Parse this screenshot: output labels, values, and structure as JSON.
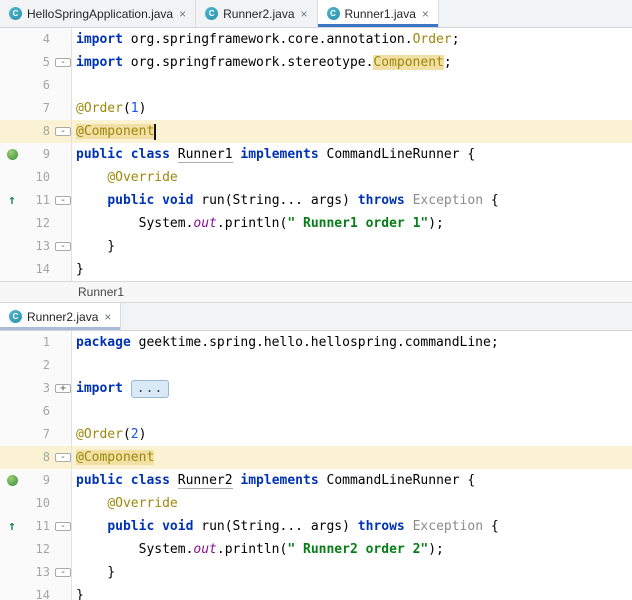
{
  "colors": {
    "tab_underline_active": "#3B76C6",
    "keyword": "#0033B3",
    "annotation": "#9E880D",
    "string": "#067D17",
    "number": "#1750EB",
    "static_field": "#871094",
    "line_highlight": "#FBF2D3",
    "occurrence_highlight": "#F1DFA4",
    "bean_icon_green": "#4E9C51"
  },
  "top_tabs": [
    {
      "label": "HelloSpringApplication.java",
      "close": "×",
      "active": false
    },
    {
      "label": "Runner2.java",
      "close": "×",
      "active": false
    },
    {
      "label": "Runner1.java",
      "close": "×",
      "active": true
    }
  ],
  "top_pane": {
    "breadcrumb": "Runner1",
    "lines": [
      {
        "n": 4,
        "t": [
          [
            "kw",
            "import"
          ],
          [
            "p",
            " org.springframework.core.annotation."
          ],
          [
            "ann",
            "Order"
          ],
          [
            "p",
            ";"
          ]
        ]
      },
      {
        "n": 5,
        "f": "minus",
        "t": [
          [
            "kw",
            "import"
          ],
          [
            "p",
            " org.springframework.stereotype."
          ],
          [
            "occ",
            "Component"
          ],
          [
            "p",
            ";"
          ]
        ]
      },
      {
        "n": 6,
        "t": []
      },
      {
        "n": 7,
        "t": [
          [
            "ann",
            "@Order"
          ],
          [
            "p",
            "("
          ],
          [
            "num",
            "1"
          ],
          [
            "p",
            ")"
          ]
        ]
      },
      {
        "n": 8,
        "hl": true,
        "f": "minus",
        "t": [
          [
            "occ",
            "@Component"
          ],
          [
            "caret",
            ""
          ]
        ]
      },
      {
        "n": 9,
        "g": "bean",
        "t": [
          [
            "kw",
            "public"
          ],
          [
            "p",
            " "
          ],
          [
            "kw",
            "class"
          ],
          [
            "p",
            " "
          ],
          [
            "cdef",
            "Runner1"
          ],
          [
            "p",
            " "
          ],
          [
            "kw",
            "implements"
          ],
          [
            "p",
            " CommandLineRunner {"
          ]
        ]
      },
      {
        "n": 10,
        "t": [
          [
            "p",
            "    "
          ],
          [
            "ann",
            "@Override"
          ]
        ]
      },
      {
        "n": 11,
        "g": "ovr",
        "f": "minus",
        "t": [
          [
            "p",
            "    "
          ],
          [
            "kw",
            "public"
          ],
          [
            "p",
            " "
          ],
          [
            "kw",
            "void"
          ],
          [
            "p",
            " run(String... args) "
          ],
          [
            "kw",
            "throws"
          ],
          [
            "p",
            " "
          ],
          [
            "cls",
            "Exception"
          ],
          [
            "p",
            " {"
          ]
        ]
      },
      {
        "n": 12,
        "t": [
          [
            "p",
            "        System."
          ],
          [
            "fld",
            "out"
          ],
          [
            "p",
            ".println("
          ],
          [
            "str",
            "\" Runner1 order 1\""
          ],
          [
            "p",
            ");"
          ]
        ]
      },
      {
        "n": 13,
        "f": "minus",
        "t": [
          [
            "p",
            "    }"
          ]
        ]
      },
      {
        "n": 14,
        "t": [
          [
            "p",
            "}"
          ]
        ]
      }
    ]
  },
  "bottom_pane": {
    "tab": {
      "label": "Runner2.java",
      "close": "×"
    },
    "lines": [
      {
        "n": 1,
        "t": [
          [
            "kw",
            "package"
          ],
          [
            "p",
            " geektime.spring.hello.hellospring.commandLine;"
          ]
        ]
      },
      {
        "n": 2,
        "t": []
      },
      {
        "n": 3,
        "f": "plus",
        "t": [
          [
            "kw",
            "import"
          ],
          [
            "p",
            " "
          ],
          [
            "fold",
            "..."
          ]
        ]
      },
      {
        "n": 6,
        "t": []
      },
      {
        "n": 7,
        "t": [
          [
            "ann",
            "@Order"
          ],
          [
            "p",
            "("
          ],
          [
            "num",
            "2"
          ],
          [
            "p",
            ")"
          ]
        ]
      },
      {
        "n": 8,
        "hl": true,
        "f": "minus",
        "t": [
          [
            "occ",
            "@Component"
          ]
        ]
      },
      {
        "n": 9,
        "g": "bean",
        "t": [
          [
            "kw",
            "public"
          ],
          [
            "p",
            " "
          ],
          [
            "kw",
            "class"
          ],
          [
            "p",
            " "
          ],
          [
            "cdef",
            "Runner2"
          ],
          [
            "p",
            " "
          ],
          [
            "kw",
            "implements"
          ],
          [
            "p",
            " CommandLineRunner {"
          ]
        ]
      },
      {
        "n": 10,
        "t": [
          [
            "p",
            "    "
          ],
          [
            "ann",
            "@Override"
          ]
        ]
      },
      {
        "n": 11,
        "g": "ovr",
        "f": "minus",
        "t": [
          [
            "p",
            "    "
          ],
          [
            "kw",
            "public"
          ],
          [
            "p",
            " "
          ],
          [
            "kw",
            "void"
          ],
          [
            "p",
            " run(String... args) "
          ],
          [
            "kw",
            "throws"
          ],
          [
            "p",
            " "
          ],
          [
            "cls",
            "Exception"
          ],
          [
            "p",
            " {"
          ]
        ]
      },
      {
        "n": 12,
        "t": [
          [
            "p",
            "        System."
          ],
          [
            "fld",
            "out"
          ],
          [
            "p",
            ".println("
          ],
          [
            "str",
            "\" Runner2 order 2\""
          ],
          [
            "p",
            ");"
          ]
        ]
      },
      {
        "n": 13,
        "f": "minus",
        "t": [
          [
            "p",
            "    }"
          ]
        ]
      },
      {
        "n": 14,
        "t": [
          [
            "p",
            "}"
          ]
        ]
      }
    ]
  }
}
